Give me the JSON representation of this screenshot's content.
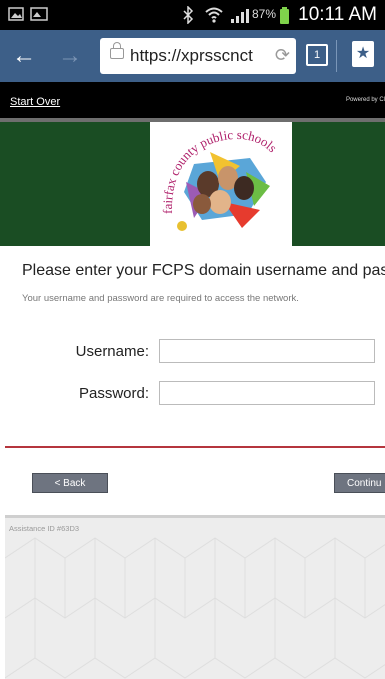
{
  "status_bar": {
    "battery_percent": "87%",
    "time": "10:11 AM"
  },
  "browser": {
    "url": "https://xprsscnct",
    "tab_count_icon": "tabs-icon"
  },
  "top_bar": {
    "start_over": "Start Over",
    "powered_by": "Powered by Cl"
  },
  "banner": {
    "logo_text": "fairfax county public schools"
  },
  "main": {
    "heading": "Please enter your FCPS domain username and pass",
    "subtext": "Your username and password are required to access the network.",
    "username_label": "Username:",
    "password_label": "Password:",
    "username_value": "",
    "password_value": ""
  },
  "buttons": {
    "back": "< Back",
    "continue": "Continu"
  },
  "footer": {
    "assistance_id": "Assistance ID #63D3"
  },
  "colors": {
    "browser_bar": "#3d5f88",
    "banner": "#1a4d23",
    "divider": "#b5353d",
    "button": "#6e7480"
  }
}
